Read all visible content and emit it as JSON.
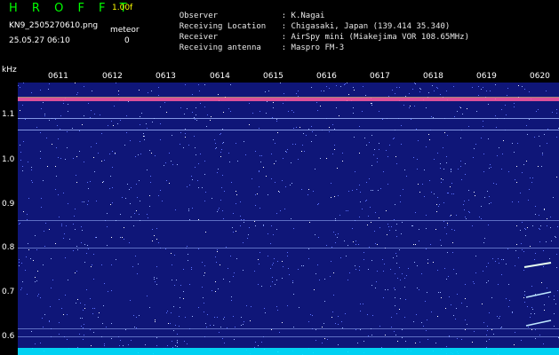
{
  "header": {
    "brand": "H R O F F T",
    "version": "1.00f",
    "filename": "KN9_2505270610.png",
    "datetime": "25.05.27 06:10",
    "meteor_label": "meteor",
    "meteor_count": "0",
    "info": [
      {
        "label": "Observer",
        "value": ": K.Nagai"
      },
      {
        "label": "Receiving Location",
        "value": ": Chigasaki, Japan (139.414 35.340)"
      },
      {
        "label": "Receiver",
        "value": ": AirSpy mini (Miakejima VOR 108.65MHz)"
      },
      {
        "label": "Receiving antenna",
        "value": ": Maspro FM-3"
      }
    ]
  },
  "axis": {
    "unit": "kHz",
    "y_ticks": [
      "1.1",
      "1.0",
      "0.9",
      "0.8",
      "0.7",
      "0.6"
    ],
    "time_ticks": [
      "0611",
      "0612",
      "0613",
      "0614",
      "0615",
      "0616",
      "0617",
      "0618",
      "0619",
      "0620"
    ]
  },
  "colors": {
    "background": "#0f1678",
    "carrier": "#ff5aa0",
    "line": "#9fb8ff",
    "noise": "#5d73ff",
    "baseline": "#00e5ff"
  }
}
